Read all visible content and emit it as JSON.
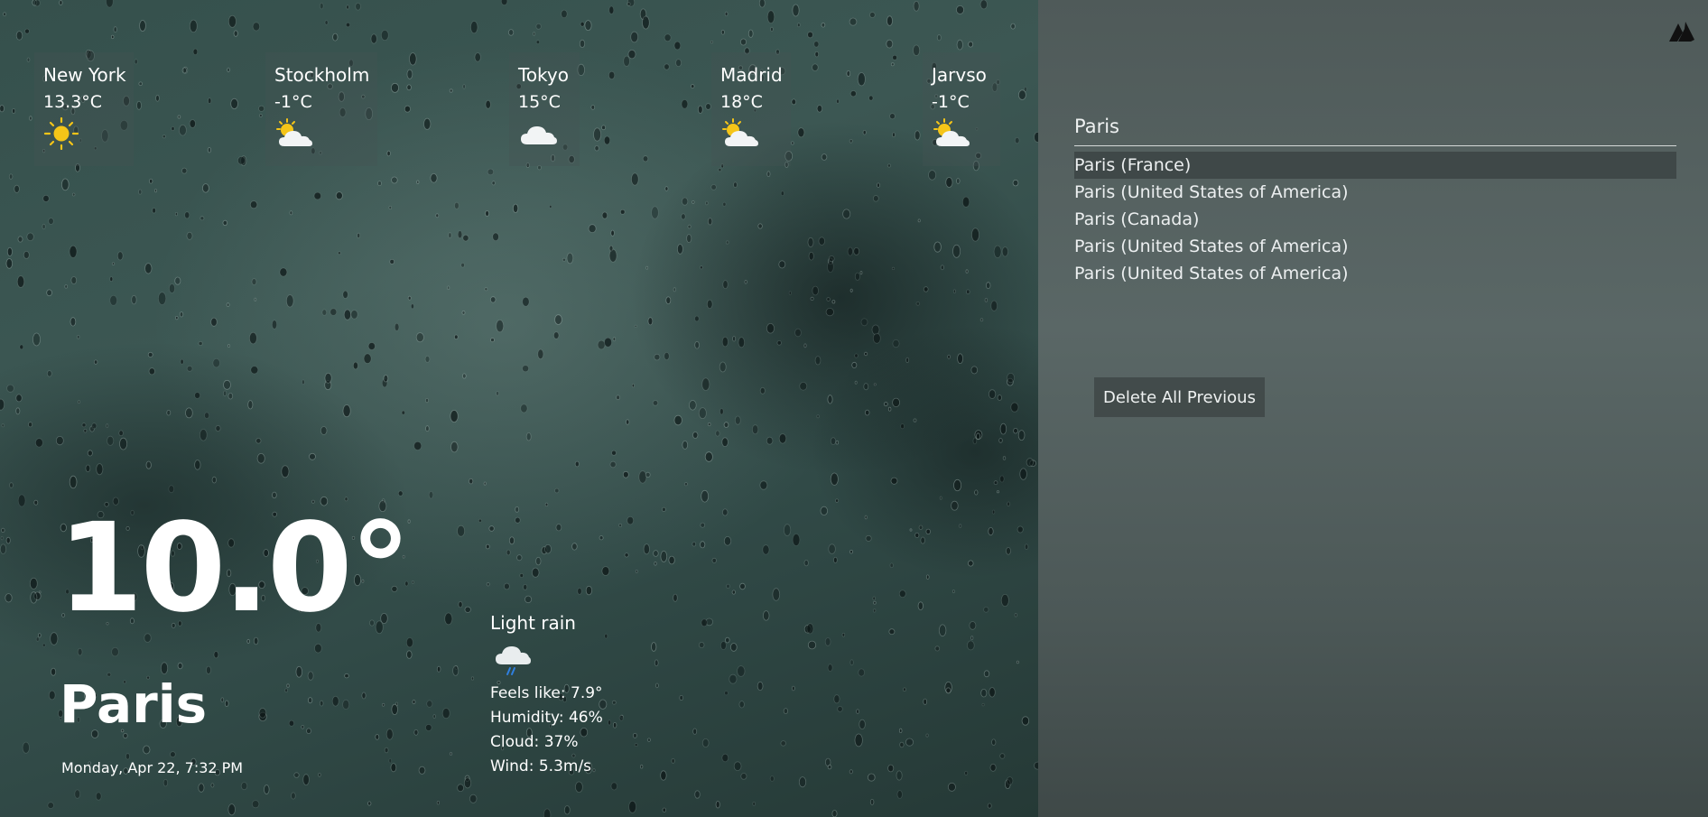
{
  "cities": [
    {
      "name": "New York",
      "temp": "13.3°C",
      "icon": "sun-icon"
    },
    {
      "name": "Stockholm",
      "temp": "-1°C",
      "icon": "partly-cloudy-icon"
    },
    {
      "name": "Tokyo",
      "temp": "15°C",
      "icon": "cloud-icon"
    },
    {
      "name": "Madrid",
      "temp": "18°C",
      "icon": "partly-cloudy-icon"
    },
    {
      "name": "Jarvso",
      "temp": "-1°C",
      "icon": "partly-cloudy-icon"
    }
  ],
  "current": {
    "temperature": "10.0°",
    "city": "Paris",
    "datetime": "Monday, Apr 22, 7:32 PM",
    "condition": "Light rain",
    "condition_icon": "rain-cloud-icon",
    "feels_like": "Feels like: 7.9°",
    "humidity": "Humidity: 46%",
    "cloud": "Cloud: 37%",
    "wind": "Wind: 5.3m/s"
  },
  "search": {
    "value": "Paris",
    "suggestions": [
      "Paris (France)",
      "Paris (United States of America)",
      "Paris (Canada)",
      "Paris (United States of America)",
      "Paris (United States of America)"
    ],
    "delete_label": "Delete All Previous"
  },
  "logo_icon": "brand-logo-icon",
  "colors": {
    "text": "#ffffff",
    "sun": "#f5c518",
    "cloud": "#f2f4f5",
    "rain": "#2f7fe0",
    "active_row": "#2d3434"
  }
}
